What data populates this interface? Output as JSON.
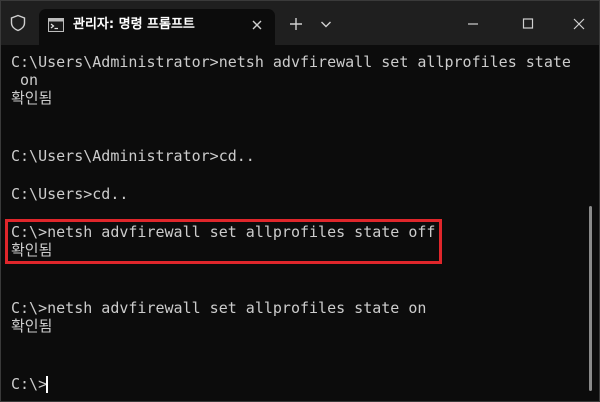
{
  "window": {
    "tab_title": "관리자: 명령 프롬프트",
    "icons": {
      "shield": "shield-icon",
      "tab": "terminal-icon",
      "tab_close": "close-icon",
      "new_tab": "plus-icon",
      "dropdown": "chevron-down-icon",
      "minimize": "minimize-icon",
      "maximize": "maximize-icon",
      "close": "close-icon"
    },
    "colors": {
      "titlebar": "#1f1f1f",
      "terminal_bg": "#0c0c0c",
      "text": "#cccccc",
      "highlight": "#e0262b"
    }
  },
  "terminal": {
    "lines": [
      "C:\\Users\\Administrator>netsh advfirewall set allprofiles state",
      " on",
      "확인됨",
      "",
      "",
      "C:\\Users\\Administrator>cd..",
      "",
      "C:\\Users>cd..",
      "",
      "C:\\>netsh advfirewall set allprofiles state off",
      "확인됨",
      "",
      "",
      "C:\\>netsh advfirewall set allprofiles state on",
      "확인됨",
      "",
      "",
      "C:\\>"
    ]
  }
}
